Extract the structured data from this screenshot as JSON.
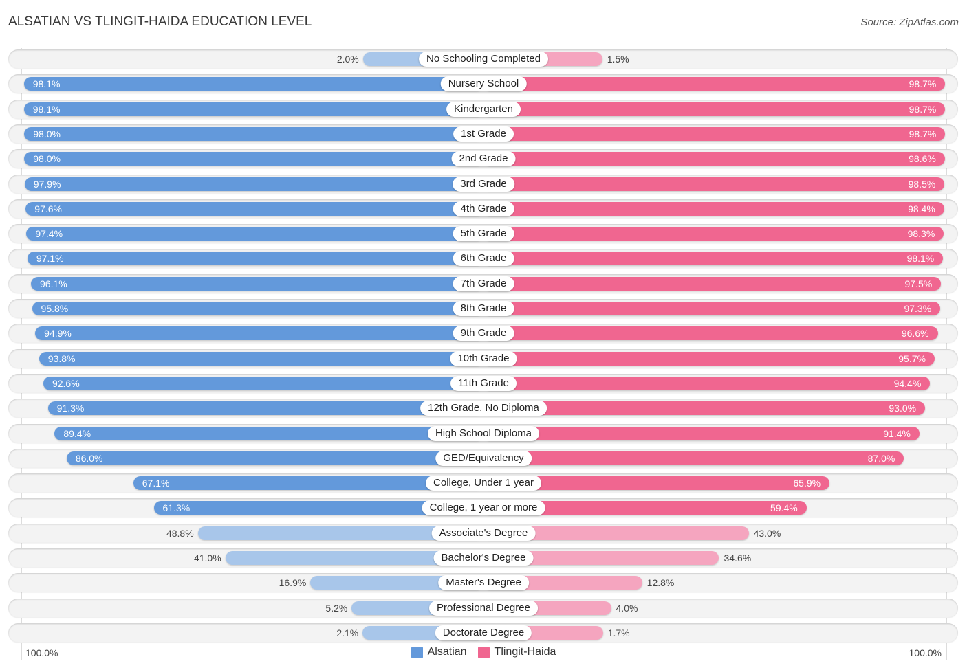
{
  "header": {
    "title": "ALSATIAN VS TLINGIT-HAIDA EDUCATION LEVEL",
    "source": "Source: ZipAtlas.com"
  },
  "colors": {
    "alsatian": "#6399db",
    "alsatian_light": "#a8c6ea",
    "tlingit": "#f06690",
    "tlingit_light": "#f5a5bf"
  },
  "chart_data": {
    "type": "bar",
    "orientation": "horizontal-diverging",
    "title": "ALSATIAN VS TLINGIT-HAIDA EDUCATION LEVEL",
    "xlabel": "",
    "ylabel": "",
    "xlim": [
      0,
      100
    ],
    "axis_labels": {
      "left": "100.0%",
      "right": "100.0%"
    },
    "legend_position": "bottom-center",
    "categories": [
      "No Schooling Completed",
      "Nursery School",
      "Kindergarten",
      "1st Grade",
      "2nd Grade",
      "3rd Grade",
      "4th Grade",
      "5th Grade",
      "6th Grade",
      "7th Grade",
      "8th Grade",
      "9th Grade",
      "10th Grade",
      "11th Grade",
      "12th Grade, No Diploma",
      "High School Diploma",
      "GED/Equivalency",
      "College, Under 1 year",
      "College, 1 year or more",
      "Associate's Degree",
      "Bachelor's Degree",
      "Master's Degree",
      "Professional Degree",
      "Doctorate Degree"
    ],
    "series": [
      {
        "name": "Alsatian",
        "side": "left",
        "values": [
          2.0,
          98.1,
          98.1,
          98.0,
          98.0,
          97.9,
          97.6,
          97.4,
          97.1,
          96.1,
          95.8,
          94.9,
          93.8,
          92.6,
          91.3,
          89.4,
          86.0,
          67.1,
          61.3,
          48.8,
          41.0,
          16.9,
          5.2,
          2.1
        ],
        "labels": [
          "2.0%",
          "98.1%",
          "98.1%",
          "98.0%",
          "98.0%",
          "97.9%",
          "97.6%",
          "97.4%",
          "97.1%",
          "96.1%",
          "95.8%",
          "94.9%",
          "93.8%",
          "92.6%",
          "91.3%",
          "89.4%",
          "86.0%",
          "67.1%",
          "61.3%",
          "48.8%",
          "41.0%",
          "16.9%",
          "5.2%",
          "2.1%"
        ]
      },
      {
        "name": "Tlingit-Haida",
        "side": "right",
        "values": [
          1.5,
          98.7,
          98.7,
          98.7,
          98.6,
          98.5,
          98.4,
          98.3,
          98.1,
          97.5,
          97.3,
          96.6,
          95.7,
          94.4,
          93.0,
          91.4,
          87.0,
          65.9,
          59.4,
          43.0,
          34.6,
          12.8,
          4.0,
          1.7
        ],
        "labels": [
          "1.5%",
          "98.7%",
          "98.7%",
          "98.7%",
          "98.6%",
          "98.5%",
          "98.4%",
          "98.3%",
          "98.1%",
          "97.5%",
          "97.3%",
          "96.6%",
          "95.7%",
          "94.4%",
          "93.0%",
          "91.4%",
          "87.0%",
          "65.9%",
          "59.4%",
          "43.0%",
          "34.6%",
          "12.8%",
          "4.0%",
          "1.7%"
        ]
      }
    ]
  },
  "legend": {
    "items": [
      {
        "label": "Alsatian"
      },
      {
        "label": "Tlingit-Haida"
      }
    ]
  }
}
